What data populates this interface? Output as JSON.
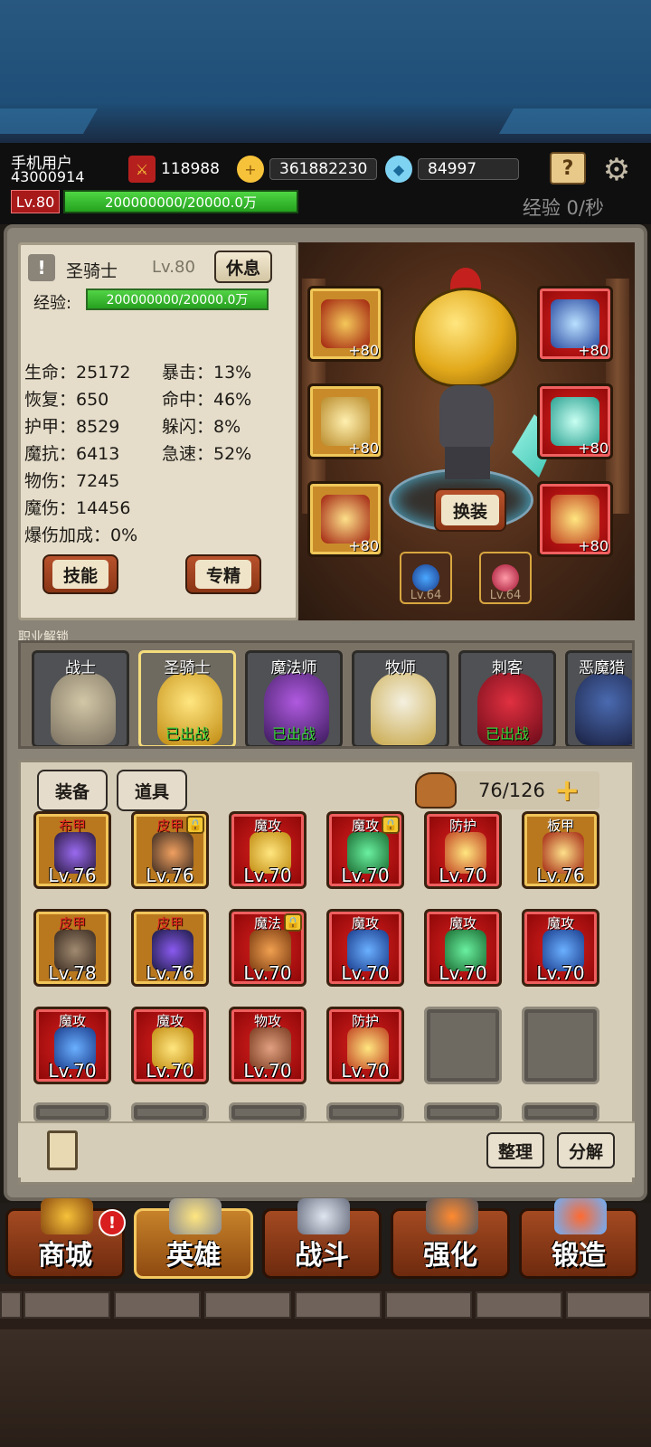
{
  "header": {
    "user_name": "手机用户",
    "user_id": "43000914",
    "power": "118988",
    "gold": "361882230",
    "diamonds": "84997",
    "level": "Lv.80",
    "xp": "200000000/20000.0万",
    "xp_rate": "经验 0/秒"
  },
  "hero_panel": {
    "name": "圣骑士",
    "level": "Lv.80",
    "rest_label": "休息",
    "exp_label": "经验:",
    "exp_value": "200000000/20000.0万",
    "stats_left": [
      "生命：25172",
      "恢复：650",
      "护甲：8529",
      "魔抗：6413",
      "物伤：7245",
      "魔伤：14456",
      "爆伤加成：0%"
    ],
    "stats_right": [
      "暴击：13%",
      "命中：46%",
      "躲闪：8%",
      "急速：52%"
    ],
    "skill_label": "技能",
    "mastery_label": "专精",
    "change_label": "换装",
    "slot_bonus": "+80",
    "gem_level": "Lv.64"
  },
  "class_section": {
    "title": "职业解锁",
    "classes": [
      {
        "name": "战士",
        "status": ""
      },
      {
        "name": "圣骑士",
        "status": "已出战"
      },
      {
        "name": "魔法师",
        "status": "已出战"
      },
      {
        "name": "牧师",
        "status": ""
      },
      {
        "name": "刺客",
        "status": "已出战"
      },
      {
        "name": "恶魔猎",
        "status": ""
      }
    ]
  },
  "inventory": {
    "tab_equipment": "装备",
    "tab_items": "道具",
    "capacity": "76/126",
    "items": [
      {
        "type": "布甲",
        "level": "Lv.76"
      },
      {
        "type": "皮甲",
        "level": "Lv.76"
      },
      {
        "type": "魔攻",
        "level": "Lv.70"
      },
      {
        "type": "魔攻",
        "level": "Lv.70"
      },
      {
        "type": "防护",
        "level": "Lv.70"
      },
      {
        "type": "板甲",
        "level": "Lv.76"
      },
      {
        "type": "皮甲",
        "level": "Lv.78"
      },
      {
        "type": "皮甲",
        "level": "Lv.76"
      },
      {
        "type": "魔法",
        "level": "Lv.70"
      },
      {
        "type": "魔攻",
        "level": "Lv.70"
      },
      {
        "type": "魔攻",
        "level": "Lv.70"
      },
      {
        "type": "魔攻",
        "level": "Lv.70"
      },
      {
        "type": "魔攻",
        "level": "Lv.70"
      },
      {
        "type": "魔攻",
        "level": "Lv.70"
      },
      {
        "type": "物攻",
        "level": "Lv.70"
      },
      {
        "type": "防护",
        "level": "Lv.70"
      }
    ],
    "sort_label": "整理",
    "decompose_label": "分解"
  },
  "nav": {
    "shop": "商城",
    "hero": "英雄",
    "battle": "战斗",
    "enhance": "强化",
    "forge": "锻造",
    "alert": "!"
  },
  "colors": {
    "accent_red": "#a8191a",
    "xp_green": "#4fd643",
    "deployed_green": "#3bd43b",
    "gold_frame": "#f1c55a"
  },
  "icons": [
    "sword-shield-icon",
    "gold-coin-icon",
    "diamond-icon",
    "quest-book-icon",
    "gear-icon",
    "warning-icon",
    "backpack-icon",
    "add-icon",
    "book-icon",
    "lock-icon"
  ]
}
